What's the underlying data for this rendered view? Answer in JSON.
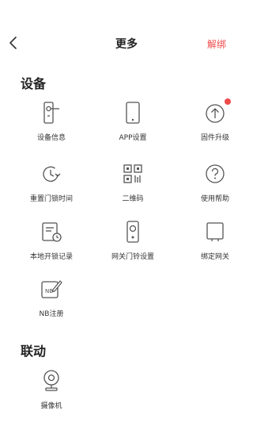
{
  "nav": {
    "title": "更多",
    "action": "解绑",
    "back_icon": "chevron-left-icon"
  },
  "sections": {
    "device": "设备",
    "linkage": "联动"
  },
  "device_items": [
    {
      "label": "设备信息",
      "icon": "door-lock-info-icon"
    },
    {
      "label": "APP设置",
      "icon": "phone-settings-icon"
    },
    {
      "label": "固件升级",
      "icon": "firmware-upgrade-icon",
      "badge": true
    },
    {
      "label": "重置门锁时间",
      "icon": "clock-reset-icon"
    },
    {
      "label": "二维码",
      "icon": "qr-code-icon"
    },
    {
      "label": "使用帮助",
      "icon": "help-icon"
    },
    {
      "label": "本地开锁记录",
      "icon": "unlock-record-icon"
    },
    {
      "label": "网关门铃设置",
      "icon": "gateway-doorbell-icon"
    },
    {
      "label": "绑定网关",
      "icon": "gateway-bind-icon"
    },
    {
      "label": "NB注册",
      "icon": "nb-register-icon"
    }
  ],
  "linkage_items": [
    {
      "label": "摄像机",
      "icon": "camera-icon"
    }
  ],
  "colors": {
    "accent": "#f04a4a",
    "icon_stroke": "#555555"
  }
}
